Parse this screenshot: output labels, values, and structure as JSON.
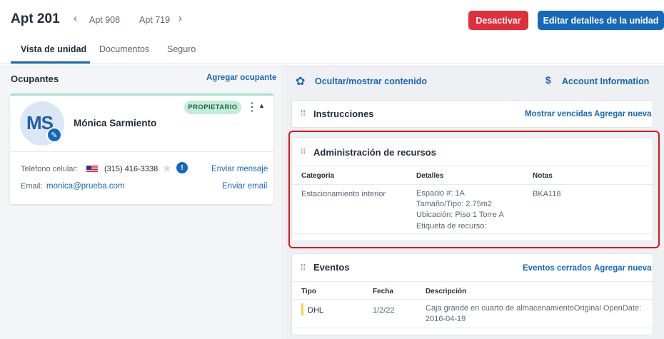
{
  "header": {
    "title": "Apt 201",
    "prev_apt": "Apt 908",
    "next_apt": "Apt 719",
    "deactivate_label": "Desactivar",
    "edit_label": "Editar detalles de la unidad"
  },
  "tabs": [
    {
      "label": "Vista de unidad",
      "active": true
    },
    {
      "label": "Documentos",
      "active": false
    },
    {
      "label": "Seguro",
      "active": false
    }
  ],
  "occupants": {
    "title": "Ocupantes",
    "add_label": "Agregar ocupante",
    "card": {
      "initials": "MS",
      "name": "Mónica Sarmiento",
      "role_badge": "PROPIETARIO",
      "phone_label": "Teléfono celular:",
      "phone_value": "(315) 416-3338",
      "phone_action": "Enviar mensaje",
      "email_label": "Email:",
      "email_value": "monica@prueba.com",
      "email_action": "Enviar email"
    }
  },
  "right": {
    "toggle_label": "Ocultar/mostrar contenido",
    "account_label": "Account Information",
    "instructions": {
      "title": "Instrucciones",
      "show_expired": "Mostrar vencidas",
      "add_new": "Agregar nueva"
    },
    "resources": {
      "title": "Administración de recursos",
      "columns": [
        "Categoría",
        "Detalles",
        "Notas"
      ],
      "rows": [
        {
          "category": "Estacionamiento interior",
          "details": [
            "Espacio #: 1A",
            "Tamaño/Tipo: 2.75m2",
            "Ubicación: Piso 1 Torre A",
            "Etiqueta de recurso:"
          ],
          "notes": "BKA118"
        }
      ]
    },
    "events": {
      "title": "Eventos",
      "closed_label": "Eventos cerrados",
      "add_new": "Agregar nueva",
      "columns": [
        "Tipo",
        "Fecha",
        "Descripción"
      ],
      "rows": [
        {
          "type": "DHL",
          "date": "1/2/22",
          "description_1": "Caja grande en cuarto de almacenamientoOriginal OpenDate:",
          "description_2": "2016-04-19"
        }
      ]
    }
  }
}
